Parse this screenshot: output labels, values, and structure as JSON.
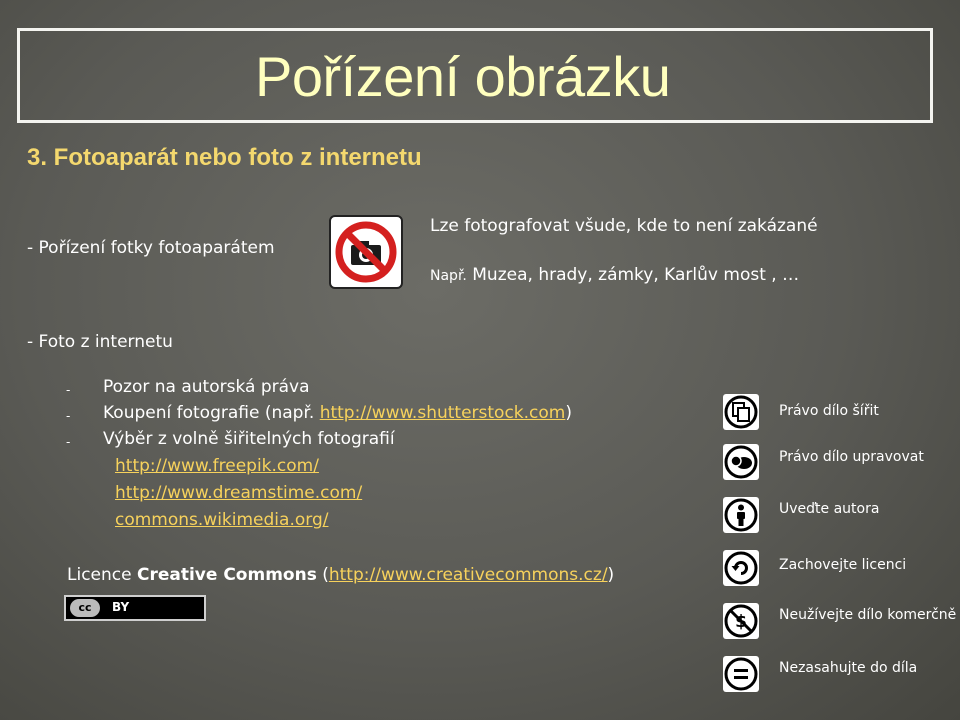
{
  "slide": {
    "title": "Pořízení obrázku",
    "subtitle": "3. Fotoaparát nebo foto z internetu"
  },
  "camera_section": {
    "left_label": "- Pořízení fotky fotoaparátem",
    "main_text": "Lze fotografovat všude, kde to není zakázané",
    "example_prefix": "Např.",
    "example_text": " Muzea, hrady, zámky, Karlův most ,  …",
    "sign_icon": "no-camera-sign-icon"
  },
  "internet_section": {
    "heading": "- Foto z internetu",
    "bullets": [
      {
        "dash": "-",
        "text": "Pozor na autorská práva"
      },
      {
        "dash": "-",
        "text_before": "Koupení fotografie (např. ",
        "link": "http://www.shutterstock.com",
        "text_after": ")"
      },
      {
        "dash": "-",
        "text": "Výběr z volně šiřitelných fotografií"
      }
    ],
    "links": [
      "http://www.freepik.com/",
      "http://www.dreamstime.com/",
      "commons.wikimedia.org/"
    ],
    "license_before": "Licence ",
    "license_bold": "Creative Commons",
    "license_open": " (",
    "license_link": "http://www.creativecommons.cz/",
    "license_close": ")",
    "badge": {
      "cc": "cc",
      "by": "BY"
    }
  },
  "cc_legend": [
    {
      "icon": "share-icon",
      "label": "Právo dílo šířit"
    },
    {
      "icon": "remix-icon",
      "label": "Právo dílo upravovat"
    },
    {
      "icon": "attribution-icon",
      "label": "Uveďte autora"
    },
    {
      "icon": "share-alike-icon",
      "label": "Zachovejte licenci"
    },
    {
      "icon": "non-commercial-icon",
      "label": "Neužívejte dílo komerčně"
    },
    {
      "icon": "no-derivatives-icon",
      "label": "Nezasahujte do díla"
    }
  ],
  "colors": {
    "title": "#ffffbe",
    "subtitle": "#f4d86e",
    "link": "#f7d25c",
    "text": "#ffffff"
  }
}
